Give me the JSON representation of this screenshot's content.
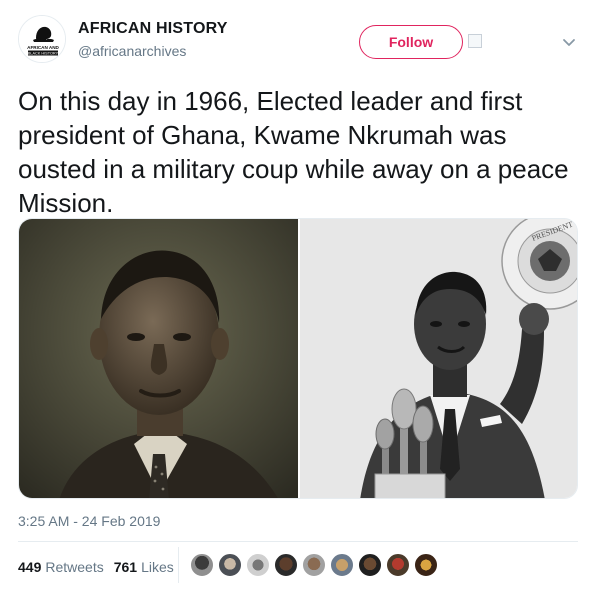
{
  "account": {
    "display_name": "AFRICAN HISTORY",
    "handle": "@africanarchives",
    "avatar_text_line1": "AFRICAN AND",
    "avatar_text_line2": "BLACK HISTORY"
  },
  "actions": {
    "follow_label": "Follow"
  },
  "tweet": {
    "text": "On this day in 1966, Elected leader and first president of Ghana, Kwame Nkrumah was ousted in a military coup while away on a peace Mission.",
    "timestamp": "3:25 AM - 24 Feb 2019"
  },
  "media": {
    "seal_text": "PRESIDENT OF THE UNITED STATES",
    "seal_text_visible_top": "PRESIDENT",
    "seal_text_visible_left": "SEAL OF THE PRESIDENT"
  },
  "stats": {
    "retweets_count": "449",
    "retweets_label": "Retweets",
    "likes_count": "761",
    "likes_label": "Likes"
  },
  "colors": {
    "follow_accent": "#e0245e",
    "secondary_text": "#657786",
    "primary_text": "#14171a",
    "divider": "#e6ecf0"
  },
  "icons": {
    "caret": "chevron-down-icon",
    "block_or_mute": "small-square-icon"
  }
}
